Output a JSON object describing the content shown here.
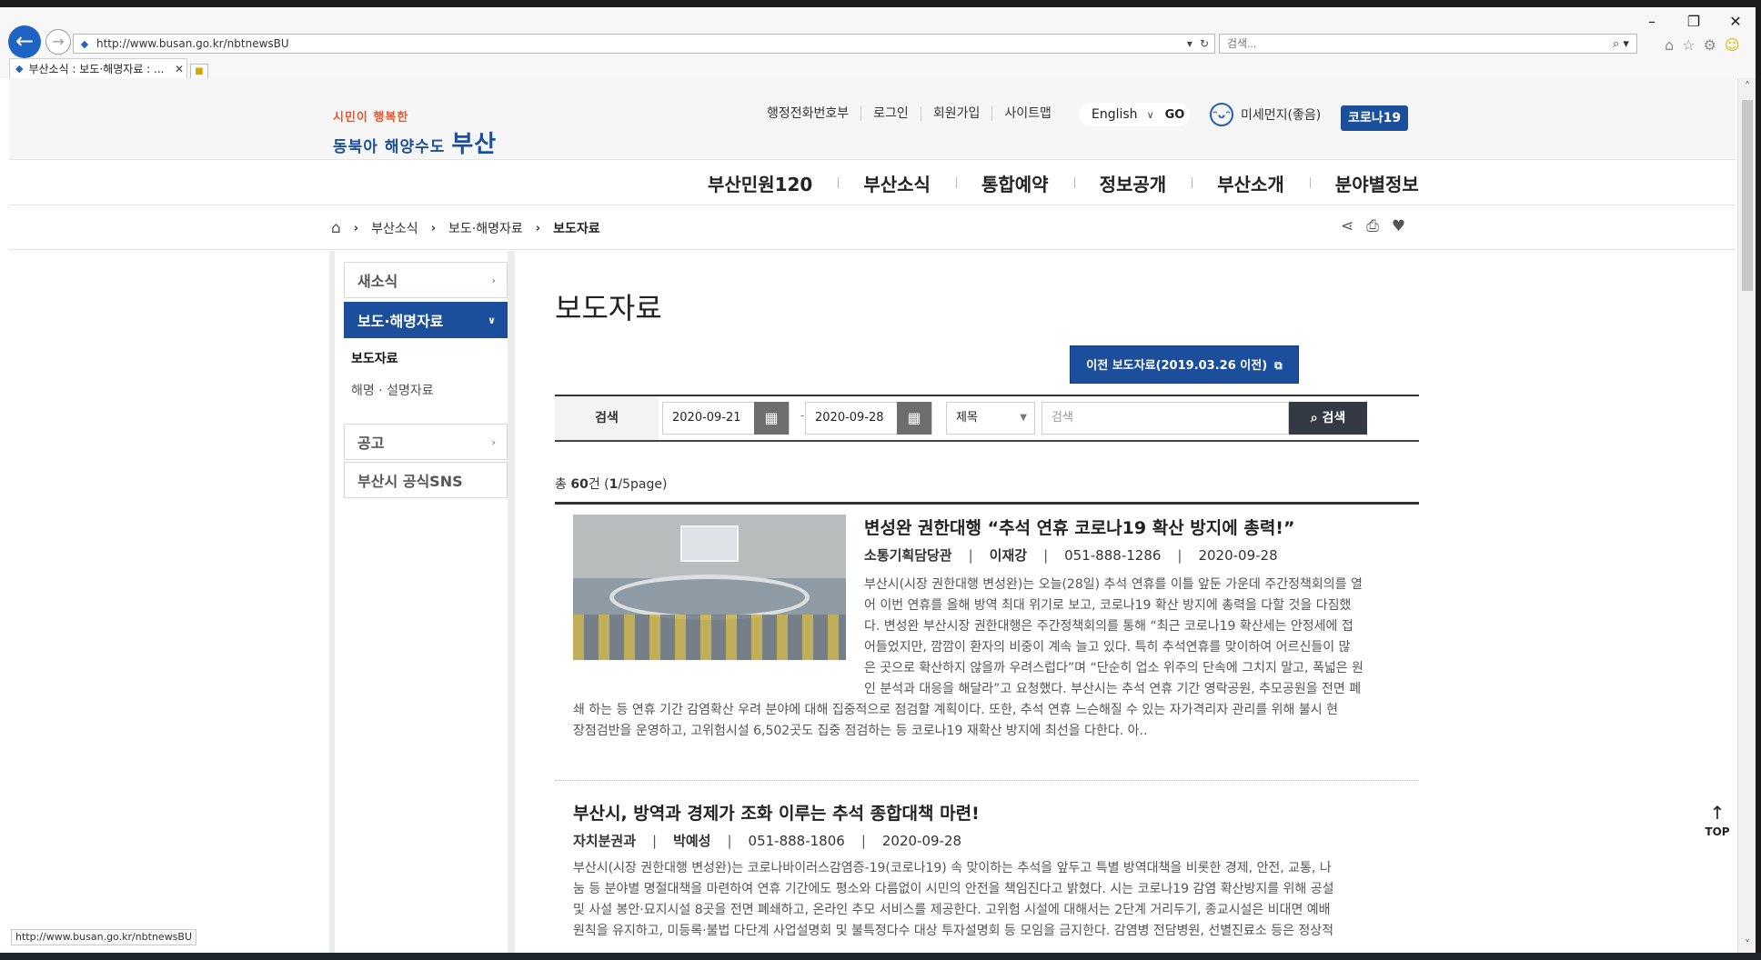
{
  "browser": {
    "url": "http://www.busan.go.kr/nbtnewsBU",
    "search_placeholder": "검색...",
    "tab_title": "부산소식 : 보도·해명자료 : ...",
    "status_url": "http://www.busan.go.kr/nbtnewsBU",
    "window_controls": [
      "minimize",
      "restore",
      "close"
    ],
    "icons": [
      "home-icon",
      "favorites-star-icon",
      "settings-gear-icon",
      "smiley-feedback-icon"
    ]
  },
  "header": {
    "logo_line1": "시민이 행복한",
    "logo_line2": "동북아 해양수도",
    "logo_city": "부산",
    "util_links": [
      "행정전화번호부",
      "로그인",
      "회원가입",
      "사이트맵"
    ],
    "language": "English",
    "go_label": "GO",
    "dust_status": "미세먼지(좋음)",
    "covid_button": "코로나19"
  },
  "gnb": [
    "부산민원120",
    "부산소식",
    "통합예약",
    "정보공개",
    "부산소개",
    "분야별정보"
  ],
  "breadcrumb": {
    "items": [
      "부산소식",
      "보도·해명자료",
      "보도자료"
    ]
  },
  "sidebar": {
    "items": [
      {
        "label": "새소식"
      },
      {
        "label": "보도·해명자료"
      },
      {
        "label": "공고"
      },
      {
        "label": "부산시 공식SNS"
      }
    ],
    "sub_items": [
      "보도자료",
      "해명 · 설명자료"
    ]
  },
  "content": {
    "page_title": "보도자료",
    "prev_button": "이전 보도자료(2019.03.26 이전)",
    "search": {
      "label": "검색",
      "date_from": "2020-09-21",
      "date_to": "2020-09-28",
      "field": "제목",
      "keyword_placeholder": "검색",
      "button": "검색"
    },
    "total_prefix": "총",
    "total_count": "60",
    "total_suffix": "건",
    "paging": "1",
    "paging_total": "/5page",
    "articles": [
      {
        "title": "변성완 권한대행 “추석 연휴 코로나19 확산 방지에 총력!”",
        "dept": "소통기획담당관",
        "person": "이재강",
        "phone": "051-888-1286",
        "date": "2020-09-28",
        "body_lines": [
          "부산시(시장 권한대행 변성완)는 오늘(28일) 추석 연휴를 이틀 앞둔 가운데 주간정책회의를 열",
          "어 이번 연휴를 올해 방역 최대 위기로 보고, 코로나19 확산 방지에 총력을 다할 것을 다짐했",
          "다. 변성완 부산시장 권한대행은 주간정책회의를 통해 “최근 코로나19 확산세는 안정세에 접",
          "어들었지만, 깜깜이 환자의 비중이 계속 늘고 있다. 특히 추석연휴를 맞이하여 어르신들이 많",
          "은 곳으로 확산하지 않을까 우려스럽다”며 “단순히 업소 위주의 단속에 그치지 말고, 폭넓은 원",
          "인 분석과 대응을 해달라”고 요청했다. 부산시는 추석 연휴 기간 영락공원, 추모공원을 전면 폐",
          "쇄 하는 등 연휴 기간 감염확산 우려 분야에 대해 집중적으로 점검할 계획이다. 또한, 추석 연휴 느슨해질 수 있는 자가격리자 관리를 위해 불시 현",
          "장점검반을 운영하고, 고위험시설 6,502곳도 집중 점검하는 등 코로나19 재확산 방지에 최선을 다한다. 아.."
        ]
      },
      {
        "title": "부산시, 방역과 경제가 조화 이루는 추석 종합대책 마련!",
        "dept": "자치분권과",
        "person": "박예성",
        "phone": "051-888-1806",
        "date": "2020-09-28",
        "body_lines": [
          "부산시(시장 권한대행 변성완)는 코로나바이러스감염증-19(코로나19) 속 맞이하는 추석을 앞두고 특별 방역대책을 비롯한 경제, 안전, 교통, 나",
          "눔 등 분야별 명절대책을 마련하여 연휴 기간에도 평소와 다름없이 시민의 안전을 책임진다고 밝혔다. 시는 코로나19 감염 확산방지를 위해 공설",
          "및 사설 봉안·묘지시설 8곳을 전면 폐쇄하고, 온라인 추모 서비스를 제공한다. 고위험 시설에 대해서는 2단계 거리두기, 종교시설은 비대면 예배",
          "원칙을 유지하고, 미등록·불법 다단계 사업설명회 및 불특정다수 대상 투자설명회 등 모임을 금지한다. 감염병 전담병원, 선별진료소 등은 정상적"
        ]
      }
    ]
  },
  "top_button": "TOP"
}
